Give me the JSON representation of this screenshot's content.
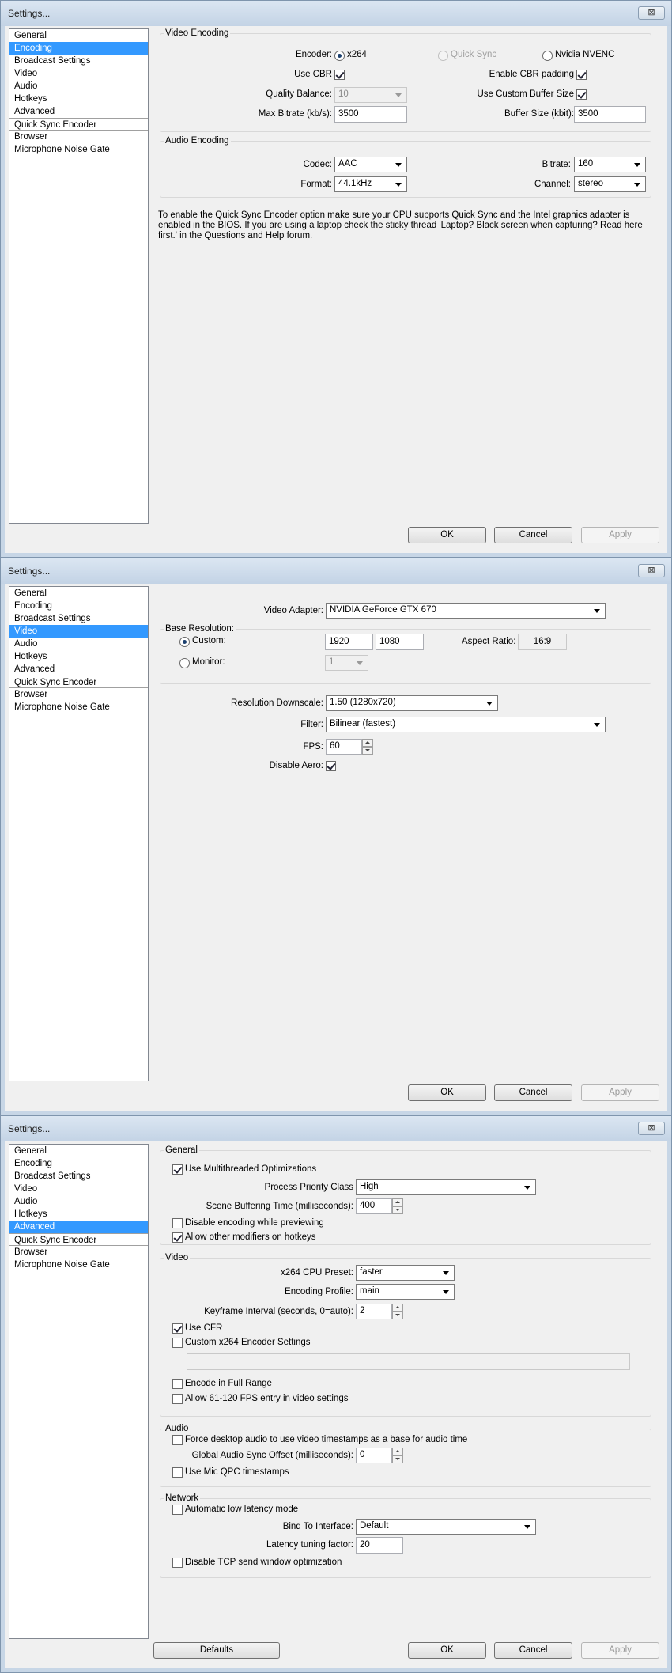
{
  "window_title": "Settings...",
  "close_symbol": "⊠",
  "sidebar_items": [
    "General",
    "Encoding",
    "Broadcast Settings",
    "Video",
    "Audio",
    "Hotkeys",
    "Advanced",
    "Quick Sync Encoder",
    "Browser",
    "Microphone Noise Gate"
  ],
  "buttons": {
    "ok": "OK",
    "cancel": "Cancel",
    "apply": "Apply",
    "defaults": "Defaults"
  },
  "encoding": {
    "video_group": "Video Encoding",
    "encoder_label": "Encoder:",
    "encoder_options": [
      "x264",
      "Quick Sync",
      "Nvidia NVENC"
    ],
    "encoder_selected": "x264",
    "use_cbr_label": "Use CBR",
    "use_cbr": true,
    "enable_cbr_padding_label": "Enable CBR padding",
    "enable_cbr_padding": true,
    "quality_balance_label": "Quality Balance:",
    "quality_balance": "10",
    "use_custom_buffer_label": "Use Custom Buffer Size",
    "use_custom_buffer": true,
    "max_bitrate_label": "Max Bitrate (kb/s):",
    "max_bitrate": "3500",
    "buffer_size_label": "Buffer Size (kbit):",
    "buffer_size": "3500",
    "audio_group": "Audio Encoding",
    "codec_label": "Codec:",
    "codec": "AAC",
    "bitrate_label": "Bitrate:",
    "bitrate": "160",
    "format_label": "Format:",
    "format": "44.1kHz",
    "channel_label": "Channel:",
    "channel": "stereo",
    "info_text": "To enable the Quick Sync Encoder option make sure your CPU supports Quick Sync and the Intel graphics adapter is enabled in the BIOS. If you are using a laptop check the sticky thread 'Laptop? Black screen when capturing? Read here first.' in the Questions and Help forum."
  },
  "video": {
    "adapter_label": "Video Adapter:",
    "adapter": "NVIDIA GeForce GTX 670",
    "base_res_group": "Base Resolution:",
    "custom_label": "Custom:",
    "custom_selected": true,
    "width": "1920",
    "height": "1080",
    "aspect_label": "Aspect Ratio:",
    "aspect": "16:9",
    "monitor_label": "Monitor:",
    "monitor": "1",
    "downscale_label": "Resolution Downscale:",
    "downscale": "1.50  (1280x720)",
    "filter_label": "Filter:",
    "filter": "Bilinear (fastest)",
    "fps_label": "FPS:",
    "fps": "60",
    "aero_label": "Disable Aero:",
    "disable_aero": true
  },
  "advanced": {
    "general_group": "General",
    "multithreaded_label": "Use Multithreaded Optimizations",
    "multithreaded": true,
    "priority_label": "Process Priority Class",
    "priority": "High",
    "scene_buffer_label": "Scene Buffering Time (milliseconds):",
    "scene_buffer": "400",
    "disable_preview_label": "Disable encoding while previewing",
    "disable_preview": false,
    "modifiers_label": "Allow other modifiers on hotkeys",
    "modifiers": true,
    "video_group": "Video",
    "preset_label": "x264 CPU Preset:",
    "preset": "faster",
    "profile_label": "Encoding Profile:",
    "profile": "main",
    "keyframe_label": "Keyframe Interval (seconds, 0=auto):",
    "keyframe": "2",
    "cfr_label": "Use CFR",
    "cfr": true,
    "custom_x264_label": "Custom x264 Encoder Settings",
    "custom_x264": false,
    "custom_x264_value": "",
    "full_range_label": "Encode in Full Range",
    "full_range": false,
    "fps_120_label": "Allow 61-120 FPS entry in video settings",
    "fps_120": false,
    "audio_group": "Audio",
    "force_desktop_label": "Force desktop audio to use video timestamps as a base for audio time",
    "force_desktop": false,
    "sync_offset_label": "Global Audio Sync Offset (milliseconds):",
    "sync_offset": "0",
    "mic_qpc_label": "Use Mic QPC timestamps",
    "mic_qpc": false,
    "network_group": "Network",
    "low_latency_label": "Automatic low latency mode",
    "low_latency": false,
    "bind_label": "Bind To Interface:",
    "bind": "Default",
    "latency_factor_label": "Latency tuning factor:",
    "latency_factor": "20",
    "tcp_label": "Disable TCP send window optimization",
    "tcp": false
  }
}
